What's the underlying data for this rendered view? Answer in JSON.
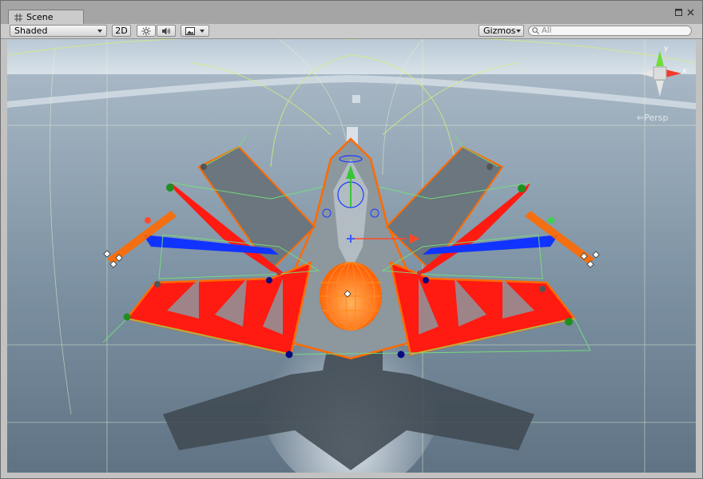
{
  "tab": {
    "title": "Scene"
  },
  "toolbar": {
    "draw_mode": "Shaded",
    "mode_2d": "2D",
    "gizmos": "Gizmos",
    "search_placeholder": "All"
  },
  "gizmo": {
    "axis_y": "y",
    "axis_x": "x",
    "projection": "Persp"
  },
  "colors": {
    "wing_red": "#ff1a12",
    "outline_orange": "#ff6a00",
    "collider_green": "#74e37a",
    "panel_blue": "#1133ff"
  }
}
